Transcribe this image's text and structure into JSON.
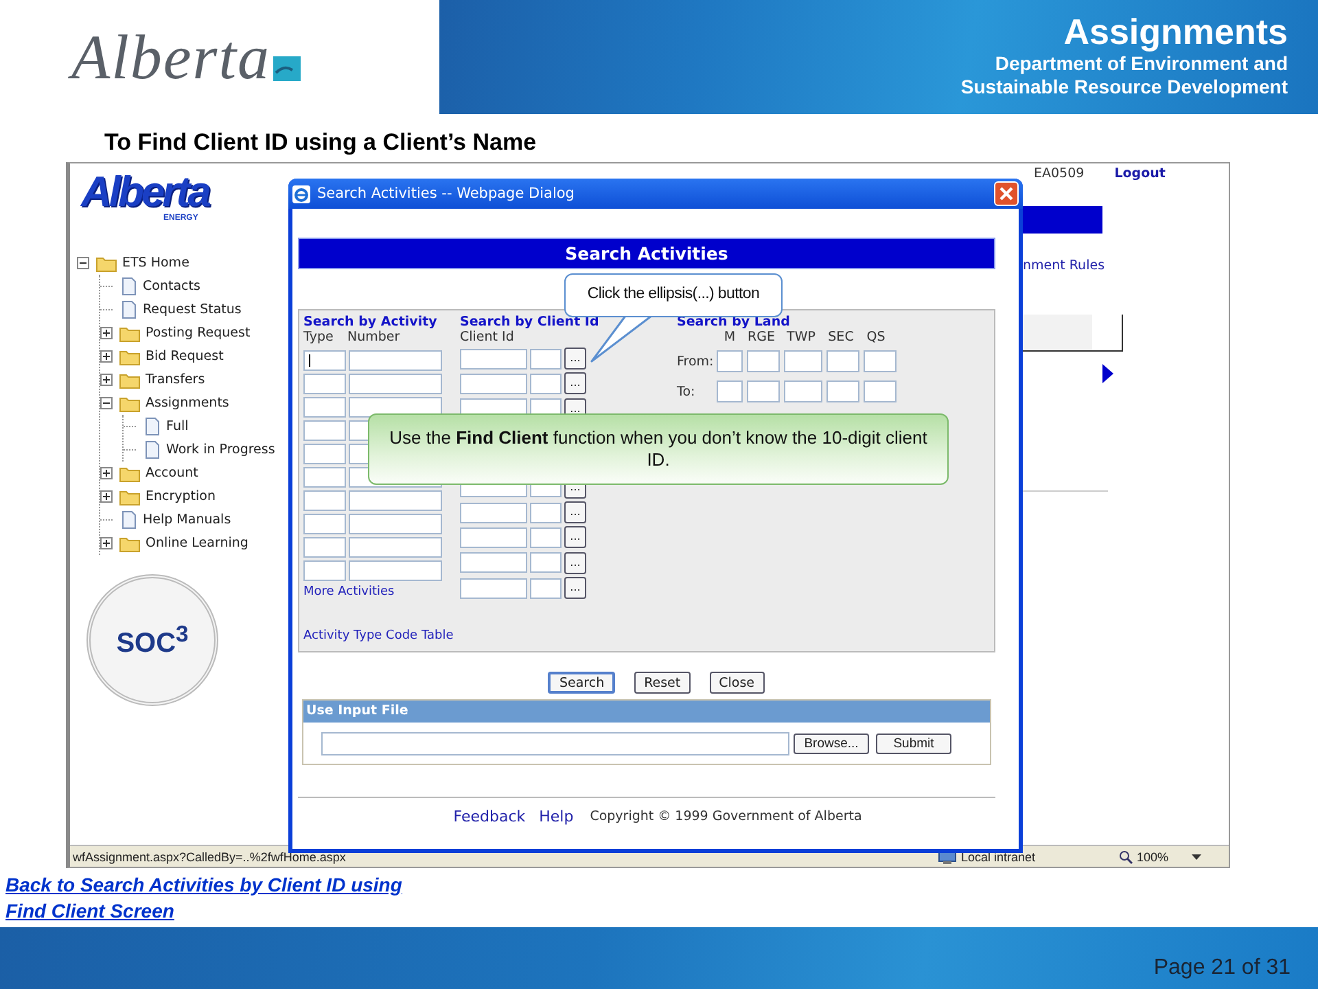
{
  "slide": {
    "logo": "Alberta",
    "title": "Assignments",
    "department": [
      "Department of Environment and",
      "Sustainable Resource Development"
    ],
    "heading": "To Find Client ID using a Client’s Name",
    "links": [
      "Back to Search Activities by Client ID using",
      "Find Client Screen"
    ],
    "page": "Page 21 of 31"
  },
  "browser": {
    "brand": "Alberta",
    "brand_sub": "ENERGY",
    "user": "EA0509",
    "logout": "Logout",
    "partial_link": "nment Rules",
    "badge": "SOC$^{3}$",
    "nav": [
      {
        "kind": "folder",
        "label": "ETS Home",
        "expanded": true,
        "children": [
          {
            "kind": "page",
            "label": "Contacts"
          },
          {
            "kind": "page",
            "label": "Request Status"
          },
          {
            "kind": "folder",
            "label": "Posting Request",
            "expanded": false
          },
          {
            "kind": "folder",
            "label": "Bid Request",
            "expanded": false
          },
          {
            "kind": "folder",
            "label": "Transfers",
            "expanded": false
          },
          {
            "kind": "folder",
            "label": "Assignments",
            "expanded": true,
            "children": [
              {
                "kind": "page",
                "label": "Full"
              },
              {
                "kind": "page",
                "label": "Work in Progress"
              }
            ]
          },
          {
            "kind": "folder",
            "label": "Account",
            "expanded": false
          },
          {
            "kind": "folder",
            "label": "Encryption",
            "expanded": false
          },
          {
            "kind": "page",
            "label": "Help Manuals"
          },
          {
            "kind": "folder",
            "label": "Online Learning",
            "expanded": false
          }
        ]
      }
    ],
    "status_bar": {
      "url": "wfAssignment.aspx?CalledBy=..%2fwfHome.aspx",
      "zone": "Local intranet",
      "zoom": "100%"
    }
  },
  "dialog": {
    "title": "Search Activities -- Webpage Dialog",
    "heading": "Search Activities",
    "activity": {
      "title": "Search by Activity",
      "columns": [
        "Type",
        "Number"
      ],
      "rows": [
        {
          "cursor": true
        },
        {
          "cursor": false
        },
        {
          "cursor": false
        },
        {
          "cursor": false
        },
        {
          "cursor": false
        },
        {
          "cursor": false
        },
        {
          "cursor": false
        },
        {
          "cursor": false
        },
        {
          "cursor": false
        },
        {
          "cursor": false
        }
      ],
      "link": "More Activities"
    },
    "client": {
      "title": "Search by Client Id",
      "column": "Client Id",
      "rows": [
        {
          "button": "..."
        },
        {
          "button": "..."
        },
        {
          "button": "..."
        },
        {
          "button": "..."
        },
        {
          "button": "..."
        },
        {
          "button": "..."
        },
        {
          "button": "..."
        },
        {
          "button": "..."
        }
      ]
    },
    "land": {
      "title": "Search by Land",
      "columns": [
        "M",
        "RGE",
        "TWP",
        "SEC",
        "QS"
      ],
      "rows": [
        {
          "label": "From:"
        },
        {
          "label": "To:"
        }
      ]
    },
    "code_table_link": "Activity Type Code Table",
    "buttons": [
      {
        "label": "Search",
        "default": true
      },
      {
        "label": "Reset",
        "default": false
      },
      {
        "label": "Close",
        "default": false
      }
    ],
    "input_file": {
      "title": "Use Input File",
      "buttons": [
        "Browse...",
        "Submit"
      ]
    },
    "footer": {
      "links": [
        "Feedback",
        "Help"
      ],
      "copyright": "Copyright © 1999 Government of Alberta"
    }
  },
  "callouts": [
    {
      "kind": "speech",
      "text": "Click the ellipsis(...) button"
    },
    {
      "kind": "note",
      "text": "Use the **Find Client** function when you don’t know the 10-digit client ID."
    }
  ]
}
